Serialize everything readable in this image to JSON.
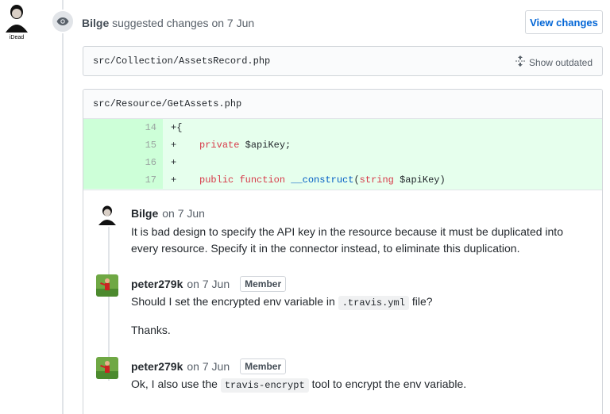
{
  "header": {
    "author": "Bilge",
    "action_text": "suggested changes on 7 Jun",
    "view_changes_label": "View changes",
    "avatar_caption": "iDead"
  },
  "outdated_file": {
    "path": "src/Collection/AssetsRecord.php",
    "show_outdated_label": "Show outdated"
  },
  "main_file": {
    "path": "src/Resource/GetAssets.php",
    "diff_lines": [
      {
        "num": "14",
        "code": "+{"
      },
      {
        "num": "15",
        "code": "+    private $apiKey;"
      },
      {
        "num": "16",
        "code": "+"
      },
      {
        "num": "17",
        "code": "+    public function __construct(string $apiKey)"
      }
    ]
  },
  "comments": [
    {
      "author": "Bilge",
      "date": "on 7 Jun",
      "badge": "",
      "body": "It is bad design to specify the API key in the resource because it must be duplicated into every resource. Specify it in the connector instead, to eliminate this duplication."
    },
    {
      "author": "peter279k",
      "date": "on 7 Jun",
      "badge": "Member",
      "body_pre": "Should I set the encrypted env variable in",
      "body_code": ".travis.yml",
      "body_post": "file?",
      "body_extra": "Thanks."
    },
    {
      "author": "peter279k",
      "date": "on 7 Jun",
      "badge": "Member",
      "body_pre": "Ok, I also use the",
      "body_code": "travis-encrypt",
      "body_post": "tool to encrypt the env variable."
    }
  ],
  "colors": {
    "link": "#0366d6",
    "addition_bg": "#e6ffed",
    "addition_num_bg": "#cdffd8"
  }
}
